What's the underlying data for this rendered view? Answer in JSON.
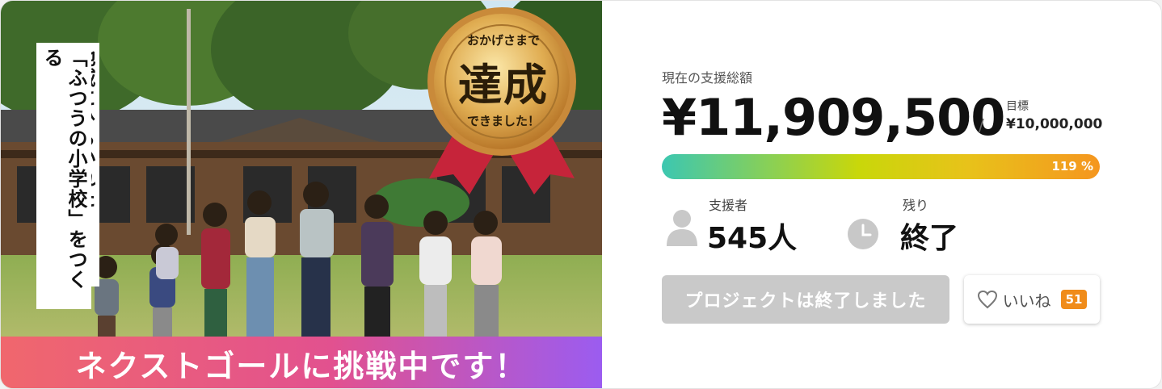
{
  "hero": {
    "vertical_text_1": "地域にひらかれた",
    "vertical_text_2": "「ふつうの小学校」をつくる",
    "medal_top": "おかげさまで",
    "medal_main": "達成",
    "medal_bottom": "できました！",
    "banner": "ネクストゴールに挑戦中です！"
  },
  "funding": {
    "total_label": "現在の支援総額",
    "total_amount": "¥11,909,500",
    "goal_label": "目標",
    "goal_amount": "¥10,000,000",
    "progress_text": "119 %",
    "progress_percent": 119,
    "bar_colors": [
      "#3cc7b1",
      "#c9d70a",
      "#f5961f"
    ]
  },
  "stats": {
    "supporters_label": "支援者",
    "supporters_value": "545人",
    "remaining_label": "残り",
    "remaining_value": "終了"
  },
  "actions": {
    "ended_label": "プロジェクトは終了しました",
    "like_label": "いいね",
    "like_count": "51"
  }
}
